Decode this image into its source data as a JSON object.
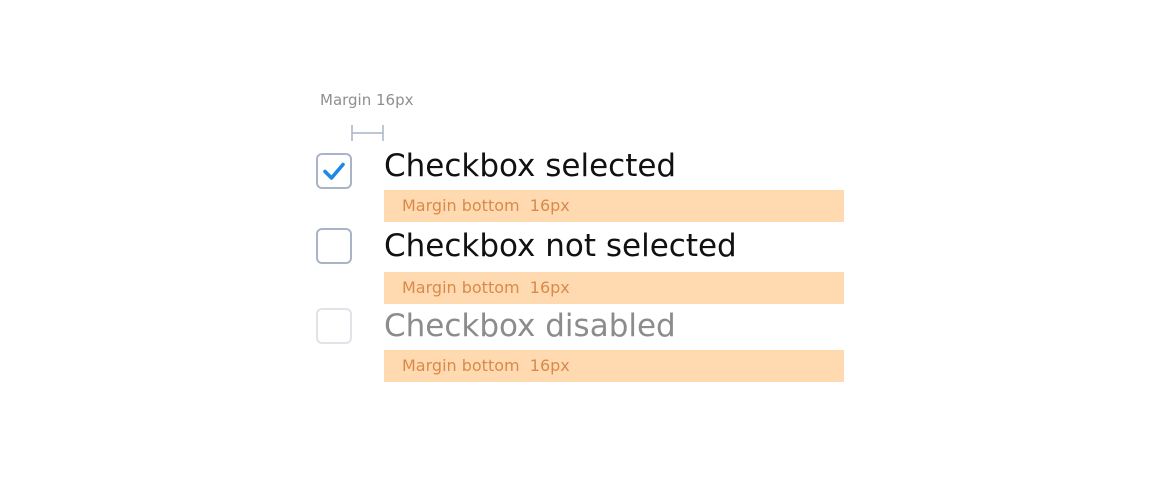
{
  "annotations": {
    "margin_left_label": "Margin 16px",
    "margin_bottom_label": "Margin bottom  16px"
  },
  "checkboxes": [
    {
      "label": "Checkbox selected",
      "state": "checked"
    },
    {
      "label": "Checkbox not selected",
      "state": "unchecked"
    },
    {
      "label": "Checkbox disabled",
      "state": "disabled"
    }
  ],
  "colors": {
    "check_mark": "#1e88e5",
    "checkbox_border": "#a9b4c6",
    "checkbox_border_disabled": "#e1e3e8",
    "margin_bar_fill": "#ffdab1",
    "margin_bar_text": "#d98a4a",
    "indicator_line": "#a9b4c6"
  },
  "icons": {
    "check": "check-icon"
  }
}
